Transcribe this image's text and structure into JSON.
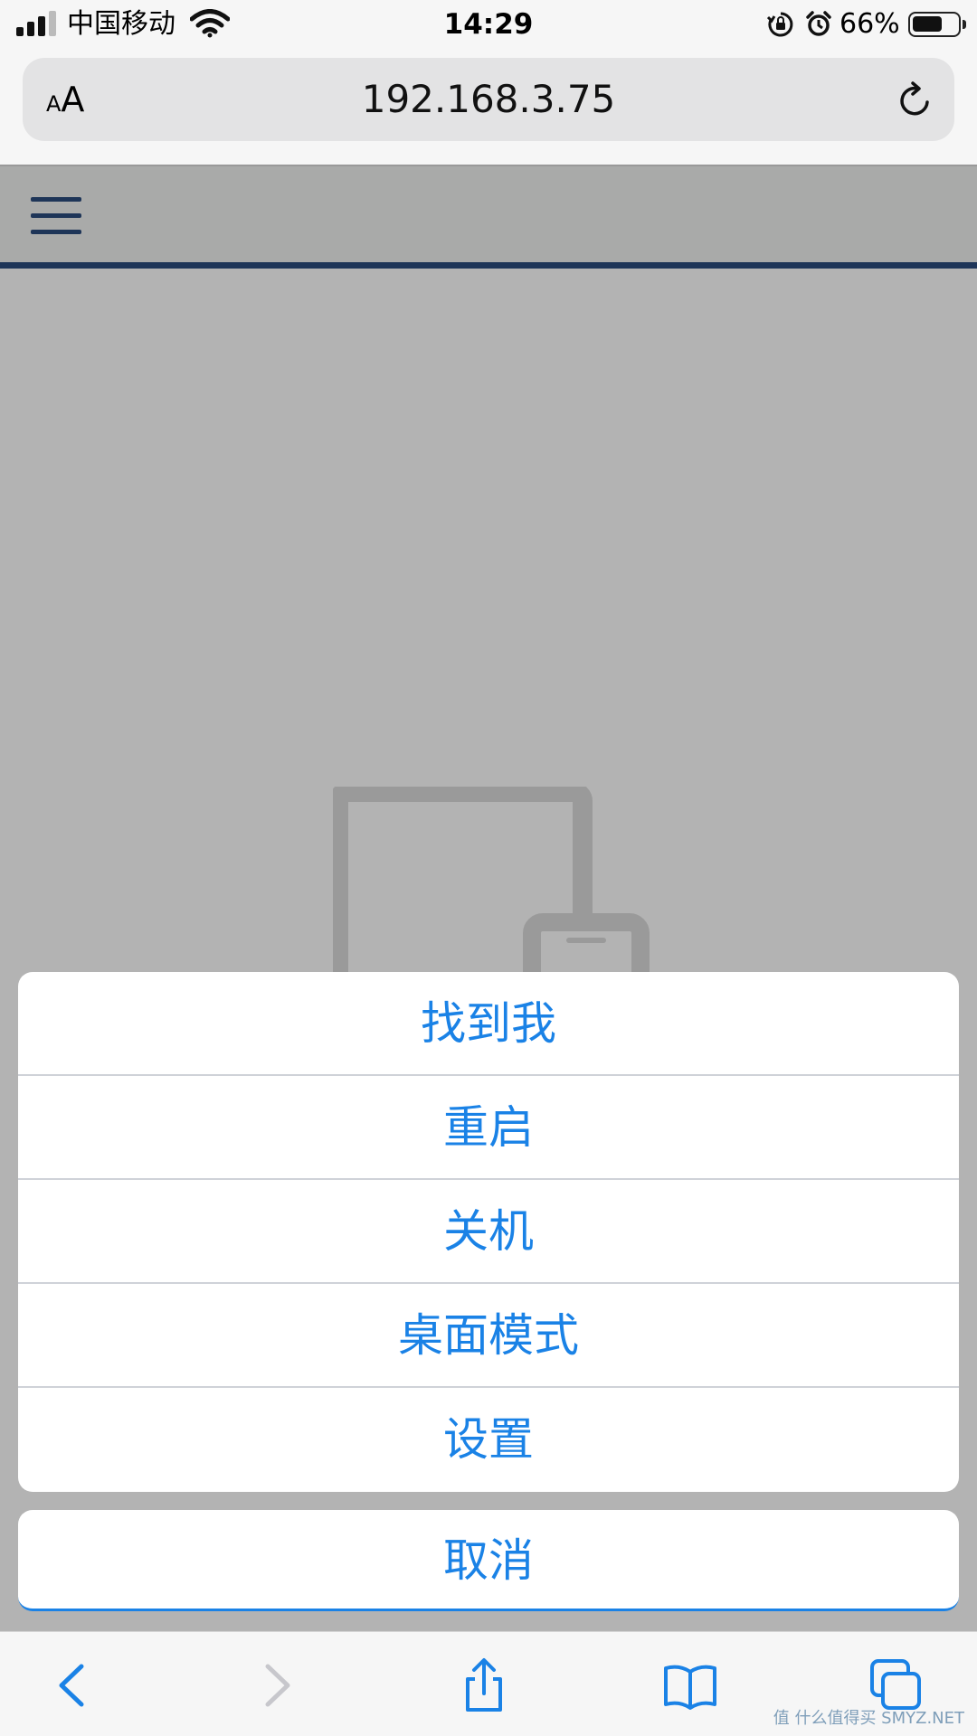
{
  "status_bar": {
    "carrier": "中国移动",
    "time": "14:29",
    "battery_percent": "66%",
    "battery_level": 0.66,
    "icons": [
      "signal-icon",
      "wifi-icon",
      "orientation-lock-icon",
      "alarm-icon",
      "battery-icon"
    ]
  },
  "address_bar": {
    "text_size_small": "A",
    "text_size_large": "A",
    "url": "192.168.3.75",
    "reload_icon": "reload-icon"
  },
  "web": {
    "menu_icon": "hamburger-menu-icon",
    "devices_icon": "devices-icon"
  },
  "action_sheet": {
    "items": [
      {
        "label": "找到我"
      },
      {
        "label": "重启"
      },
      {
        "label": "关机"
      },
      {
        "label": "桌面模式"
      },
      {
        "label": "设置"
      }
    ],
    "cancel_label": "取消"
  },
  "toolbar": {
    "icons": [
      "back-icon",
      "forward-icon",
      "share-icon",
      "bookmarks-icon",
      "tabs-icon"
    ]
  },
  "colors": {
    "accent": "#1a82e6",
    "web_header_rule": "#1e3558",
    "dim_overlay": "#b3b3b3"
  },
  "watermark": "值 什么值得买 SMYZ.NET"
}
